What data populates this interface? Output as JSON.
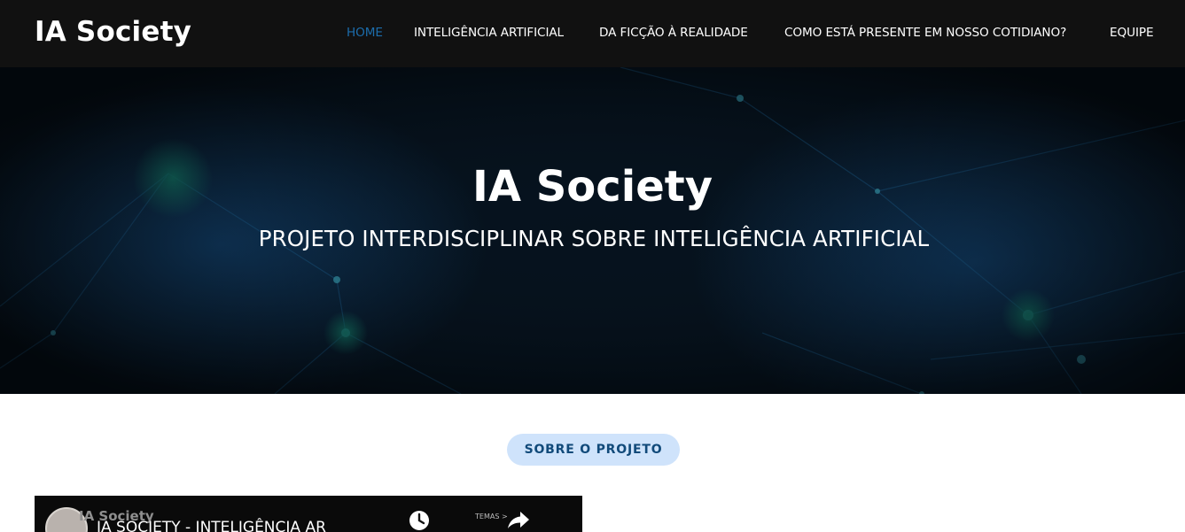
{
  "brand": "IA Society",
  "nav": {
    "items": [
      {
        "label": "HOME",
        "active": true
      },
      {
        "label": "INTELIGÊNCIA ARTIFICIAL",
        "active": false
      },
      {
        "label": "DA FICÇÃO À REALIDADE",
        "active": false
      },
      {
        "label": "COMO ESTÁ PRESENTE EM NOSSO COTIDIANO?",
        "active": false
      },
      {
        "label": "EQUIPE",
        "active": false
      }
    ]
  },
  "hero": {
    "title": "IA Society",
    "subtitle": "PROJETO INTERDISCIPLINAR SOBRE INTELIGÊNCIA ARTIFICIAL"
  },
  "about": {
    "label": "SOBRE O PROJETO"
  },
  "video": {
    "channel": "IA Society",
    "title": "IA SOCIETY - INTELIGÊNCIA AR",
    "temas_label": "TEMAS >"
  },
  "colors": {
    "topbar": "#111111",
    "nav_active": "#1c6dac",
    "pill_bg": "#cfe3fb",
    "pill_text": "#114a7a"
  },
  "icons": [
    "clock-icon",
    "share-icon"
  ]
}
